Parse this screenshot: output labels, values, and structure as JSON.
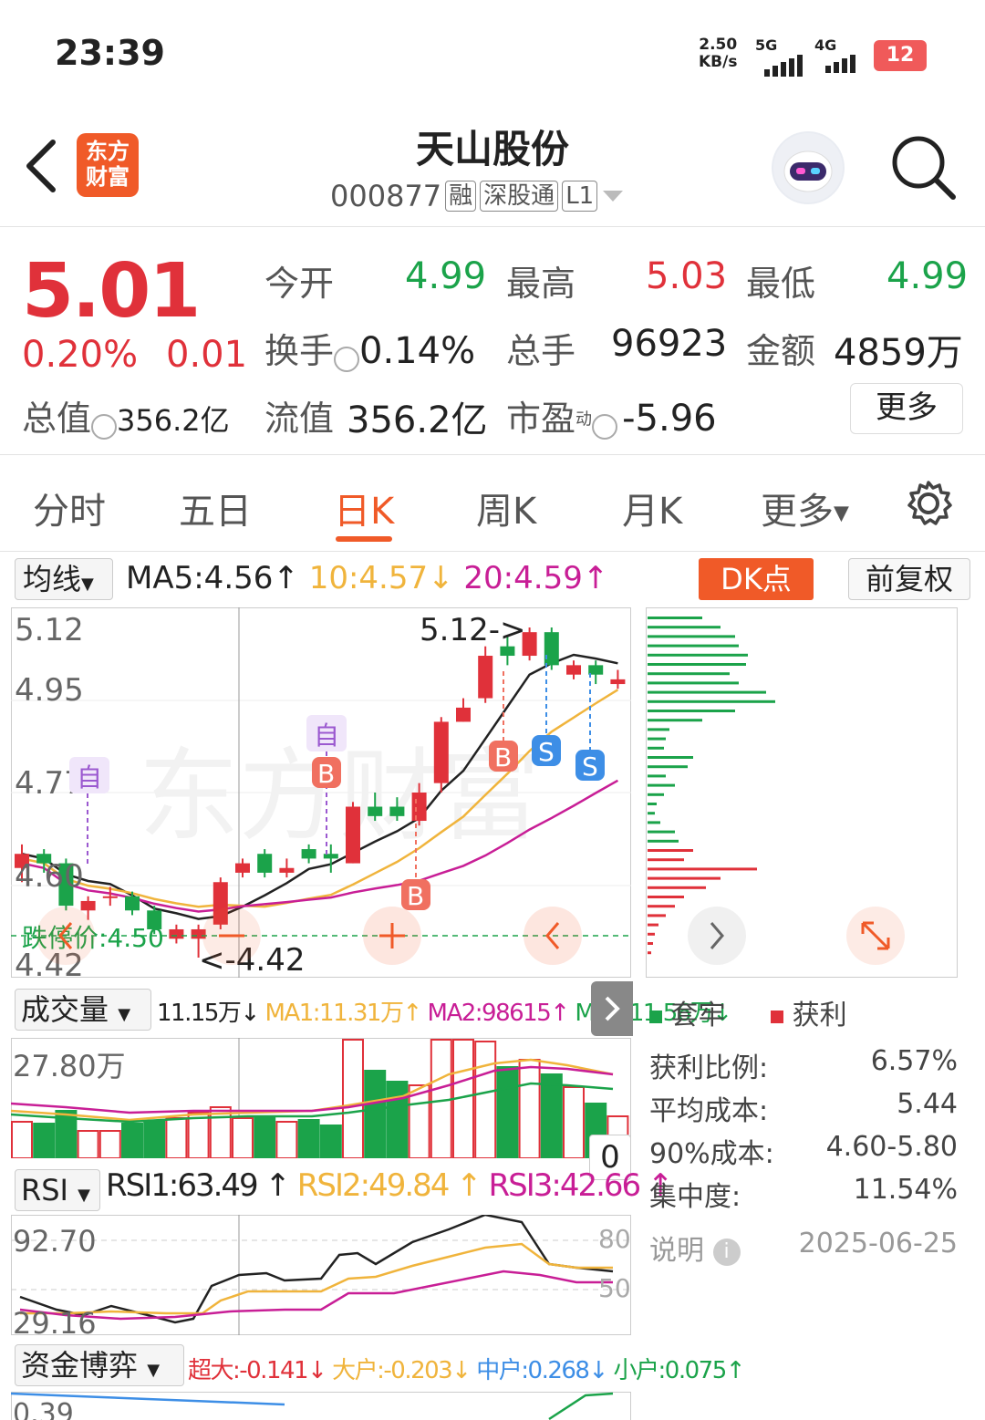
{
  "status_bar": {
    "time": "23:39",
    "net_speed_value": "2.50",
    "net_speed_unit": "KB/s",
    "net1": "5G",
    "net2": "4G",
    "battery": "12"
  },
  "header": {
    "logo_line1": "东方",
    "logo_line2": "财富",
    "stock_name": "天山股份",
    "stock_code": "000877",
    "tags": [
      "融",
      "深股通",
      "L1"
    ]
  },
  "quote": {
    "price": "5.01",
    "change_pct": "0.20%",
    "change": "0.01",
    "market_cap_label": "总值",
    "market_cap": "356.2亿",
    "open_label": "今开",
    "open": "4.99",
    "high_label": "最高",
    "high": "5.03",
    "low_label": "最低",
    "low": "4.99",
    "turnover_label": "换手",
    "turnover": "0.14%",
    "volume_label": "总手",
    "volume": "96923",
    "amount_label": "金额",
    "amount": "4859万",
    "float_cap_label": "流值",
    "float_cap": "356.2亿",
    "pe_label": "市盈",
    "pe_sup": "动",
    "pe": "-5.96",
    "more": "更多"
  },
  "tabs": [
    "分时",
    "五日",
    "日K",
    "周K",
    "月K",
    "更多"
  ],
  "kline": {
    "indicator": "均线",
    "ma5": "MA5:4.56",
    "ma10": "10:4.57",
    "ma20": "20:4.59",
    "dk_btn": "DK点",
    "adjust_btn": "前复权",
    "y_labels": [
      "5.12",
      "4.95",
      "4.77",
      "4.60",
      "4.42"
    ],
    "high_mark": "5.12->",
    "low_mark": "<-4.42",
    "stop_price": "跌停价:4.50",
    "tags": [
      "自",
      "自",
      "B",
      "B",
      "B",
      "S",
      "S"
    ],
    "colors": {
      "up": "#e0313a",
      "down": "#1ba34a",
      "ma5": "#222222",
      "ma10": "#f0b43c",
      "ma20": "#c81e96"
    }
  },
  "volume": {
    "label": "成交量",
    "value": "11.15万",
    "ma1": "MA1:11.31万",
    "ma2": "MA2:98615",
    "ma3": "MA3:11.56万",
    "y_max": "27.80万",
    "zero": "0"
  },
  "rsi": {
    "label": "RSI",
    "rsi1": "RSI1:63.49",
    "rsi2": "RSI2:49.84",
    "rsi3": "RSI3:42.66",
    "y_top": "92.70",
    "y_bottom": "29.16",
    "level80": "80",
    "level50": "50"
  },
  "funds": {
    "label": "资金博弈",
    "super": "超大:-0.141",
    "large": "大户:-0.203",
    "mid": "中户:0.268",
    "small": "小户:0.075",
    "y_top": "0.39"
  },
  "chips": {
    "legend_loss": "套牢",
    "legend_profit": "获利",
    "rows": [
      {
        "label": "获利比例:",
        "value": "6.57%"
      },
      {
        "label": "平均成本:",
        "value": "5.44"
      },
      {
        "label": "90%成本:",
        "value": "4.60-5.80"
      },
      {
        "label": "集中度:",
        "value": "11.54%"
      }
    ],
    "note_label": "说明",
    "date": "2025-06-25"
  },
  "chart_data": {
    "type": "candlestick",
    "candles": [
      {
        "o": 4.61,
        "c": 4.64,
        "h": 4.66,
        "l": 4.58
      },
      {
        "o": 4.64,
        "c": 4.62,
        "h": 4.65,
        "l": 4.6
      },
      {
        "o": 4.62,
        "c": 4.53,
        "h": 4.63,
        "l": 4.52
      },
      {
        "o": 4.52,
        "c": 4.54,
        "h": 4.55,
        "l": 4.5
      },
      {
        "o": 4.55,
        "c": 4.55,
        "h": 4.57,
        "l": 4.53
      },
      {
        "o": 4.55,
        "c": 4.52,
        "h": 4.56,
        "l": 4.51
      },
      {
        "o": 4.52,
        "c": 4.48,
        "h": 4.53,
        "l": 4.47
      },
      {
        "o": 4.46,
        "c": 4.48,
        "h": 4.49,
        "l": 4.45
      },
      {
        "o": 4.46,
        "c": 4.48,
        "h": 4.49,
        "l": 4.42
      },
      {
        "o": 4.49,
        "c": 4.58,
        "h": 4.59,
        "l": 4.48
      },
      {
        "o": 4.6,
        "c": 4.62,
        "h": 4.63,
        "l": 4.59
      },
      {
        "o": 4.64,
        "c": 4.6,
        "h": 4.65,
        "l": 4.59
      },
      {
        "o": 4.6,
        "c": 4.61,
        "h": 4.63,
        "l": 4.59
      },
      {
        "o": 4.65,
        "c": 4.63,
        "h": 4.66,
        "l": 4.62
      },
      {
        "o": 4.64,
        "c": 4.63,
        "h": 4.66,
        "l": 4.6
      },
      {
        "o": 4.62,
        "c": 4.74,
        "h": 4.75,
        "l": 4.62
      },
      {
        "o": 4.74,
        "c": 4.72,
        "h": 4.77,
        "l": 4.71
      },
      {
        "o": 4.74,
        "c": 4.72,
        "h": 4.76,
        "l": 4.71
      },
      {
        "o": 4.71,
        "c": 4.77,
        "h": 4.79,
        "l": 4.7
      },
      {
        "o": 4.79,
        "c": 4.92,
        "h": 4.93,
        "l": 4.77
      },
      {
        "o": 4.92,
        "c": 4.95,
        "h": 4.97,
        "l": 4.92
      },
      {
        "o": 4.97,
        "c": 5.06,
        "h": 5.08,
        "l": 4.96
      },
      {
        "o": 5.08,
        "c": 5.06,
        "h": 5.1,
        "l": 5.04
      },
      {
        "o": 5.06,
        "c": 5.11,
        "h": 5.12,
        "l": 5.05
      },
      {
        "o": 5.11,
        "c": 5.04,
        "h": 5.12,
        "l": 5.03
      },
      {
        "o": 5.02,
        "c": 5.04,
        "h": 5.05,
        "l": 5.01
      },
      {
        "o": 5.04,
        "c": 5.02,
        "h": 5.05,
        "l": 5.0
      },
      {
        "o": 5.0,
        "c": 5.01,
        "h": 5.03,
        "l": 4.99
      }
    ],
    "ylim": [
      4.42,
      5.12
    ]
  }
}
